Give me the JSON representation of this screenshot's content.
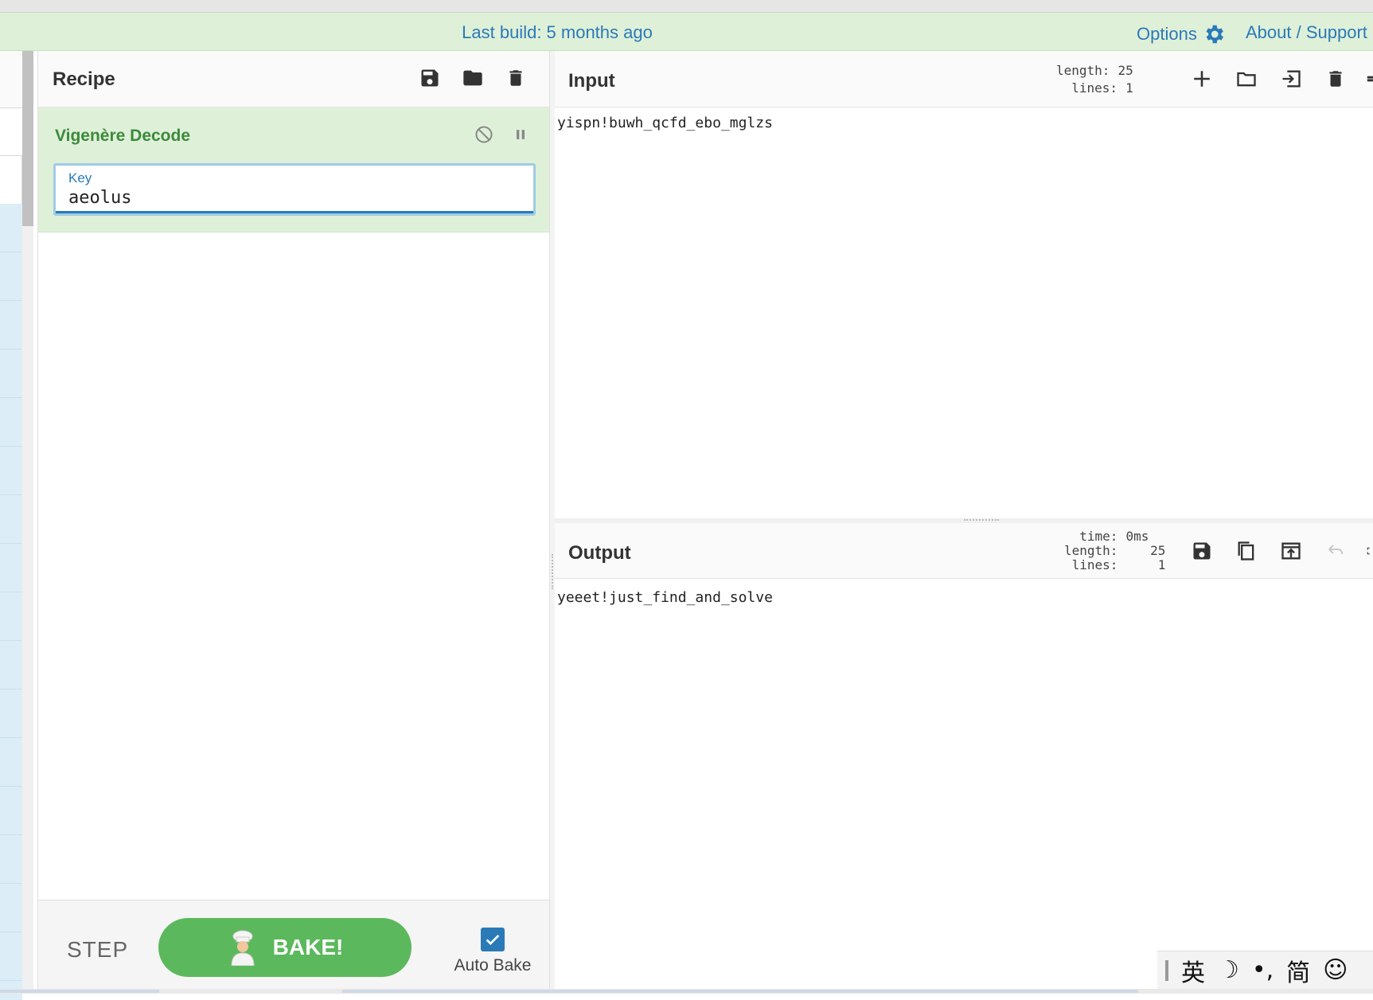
{
  "banner": {
    "build_text": "Last build: 5 months ago",
    "options_label": "Options",
    "about_label": "About / Support"
  },
  "recipe": {
    "title": "Recipe",
    "operation": {
      "name": "Vigenère Decode",
      "arg_label": "Key",
      "arg_value": "aeolus"
    },
    "step_label": "STEP",
    "bake_label": "BAKE!",
    "auto_bake_label": "Auto Bake",
    "auto_bake_checked": true
  },
  "input": {
    "title": "Input",
    "stats": {
      "length_label": "length:",
      "length": "25",
      "lines_label": "lines:",
      "lines": "1"
    },
    "text": "yispn!buwh_qcfd_ebo_mglzs"
  },
  "output": {
    "title": "Output",
    "stats": {
      "time_label": "time:",
      "time": "0ms",
      "length_label": "length:",
      "length": "25",
      "lines_label": "lines:",
      "lines": "1"
    },
    "text": "yeeet!just_find_and_solve"
  },
  "ime": {
    "lang": "英",
    "moon": "☽",
    "punct": "•,",
    "simplified": "简",
    "emoji": "☺"
  },
  "colors": {
    "banner_bg": "#dff0d8",
    "link": "#2a7ab8",
    "op_title": "#3c8a3c",
    "bake_green": "#5cb85c"
  }
}
